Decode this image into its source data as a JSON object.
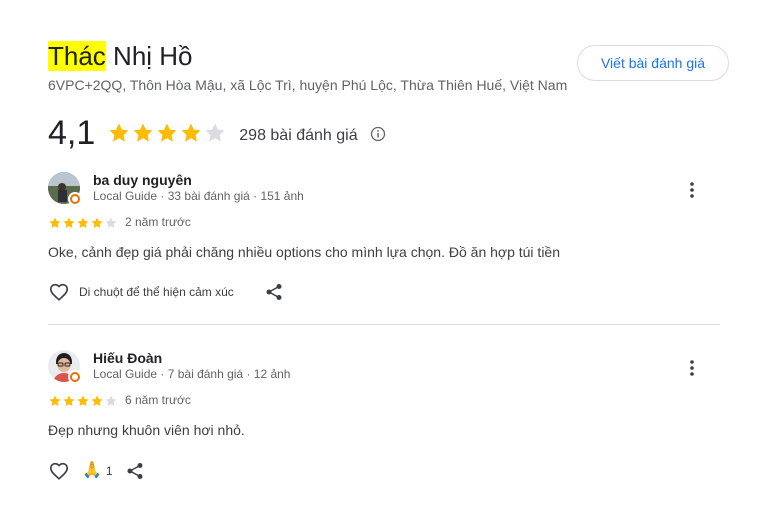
{
  "place": {
    "title_highlight": "Thác",
    "title_rest": " Nhị Hồ",
    "address": "6VPC+2QQ, Thôn Hòa Mậu, xã Lộc Trì, huyện Phú Lộc, Thừa Thiên Huế, Việt Nam",
    "write_review_label": "Viết bài đánh giá",
    "rating": "4,1",
    "stars": 4.1,
    "review_count": "298 bài đánh giá"
  },
  "reviews": [
    {
      "name": "ba duy nguyên",
      "meta": "Local Guide · 33 bài đánh giá · 151 ảnh",
      "stars": 4,
      "time": "2 năm trước",
      "text": "Oke, cảnh đẹp giá phải chăng nhiều options cho mình lựa chọn. Đồ ăn hợp túi tiền",
      "hover_hint": "Di chuột để thể hiện cảm xúc"
    },
    {
      "name": "Hiếu Đoàn",
      "meta": "Local Guide · 7 bài đánh giá · 12 ảnh",
      "stars": 4,
      "time": "6 năm trước",
      "text": "Đẹp nhưng khuôn viên hơi nhỏ.",
      "reaction_emoji": "🙏",
      "reaction_count": "1"
    }
  ],
  "colors": {
    "star": "#fbbc04",
    "star_empty": "#dadce0",
    "accent": "#1a73e8",
    "highlight": "#ffff00",
    "badge": "#e8710a"
  },
  "icons": [
    "star-icon",
    "info-icon",
    "more-vert-icon",
    "heart-icon",
    "share-icon",
    "local-guide-badge-icon"
  ]
}
